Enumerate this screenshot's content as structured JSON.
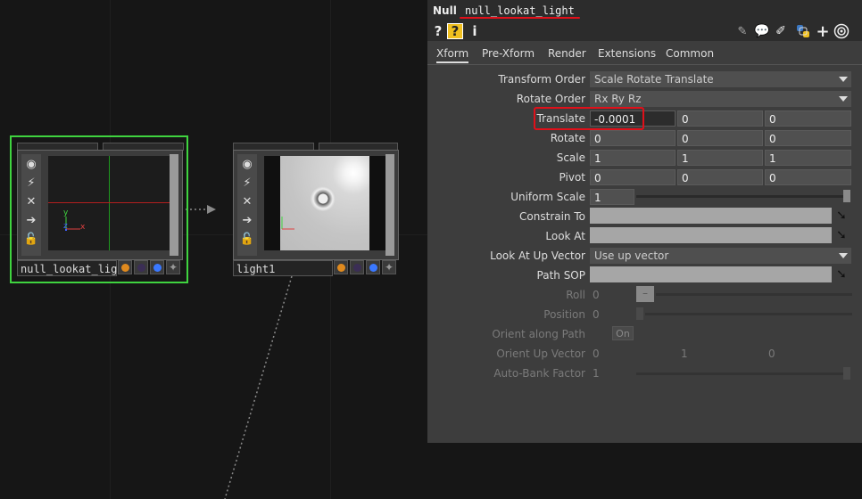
{
  "network": {
    "nodes": [
      {
        "name": "null_lookat_light",
        "selected": true
      },
      {
        "name": "light1",
        "selected": false
      }
    ],
    "side_icons": [
      "viewer-icon",
      "bypass-icon",
      "delete-icon",
      "arrow-right-icon",
      "lock-icon"
    ],
    "flag_colors": [
      "#e08a1e",
      "#3b2e55",
      "#3a78ff",
      "#555555"
    ],
    "axis_labels": {
      "y": "y",
      "z": "z",
      "x": "x"
    }
  },
  "panel": {
    "op_type": "Null",
    "op_name": "null_lookat_light",
    "toolbar": {
      "help": "?",
      "help_python": "?",
      "info": "i"
    },
    "tabs": [
      "Xform",
      "Pre-Xform",
      "Render",
      "Extensions",
      "Common"
    ],
    "active_tab": "Xform",
    "params": {
      "transform_order": {
        "label": "Transform Order",
        "value": "Scale Rotate Translate"
      },
      "rotate_order": {
        "label": "Rotate Order",
        "value": "Rx Ry Rz"
      },
      "translate": {
        "label": "Translate",
        "x": "-0.0001",
        "y": "0",
        "z": "0"
      },
      "rotate": {
        "label": "Rotate",
        "x": "0",
        "y": "0",
        "z": "0"
      },
      "scale": {
        "label": "Scale",
        "x": "1",
        "y": "1",
        "z": "1"
      },
      "pivot": {
        "label": "Pivot",
        "x": "0",
        "y": "0",
        "z": "0"
      },
      "uniform_scale": {
        "label": "Uniform Scale",
        "value": "1"
      },
      "constrain_to": {
        "label": "Constrain To"
      },
      "look_at": {
        "label": "Look At"
      },
      "look_at_up_vector": {
        "label": "Look At Up Vector",
        "value": "Use up vector"
      },
      "path_sop": {
        "label": "Path SOP"
      },
      "roll": {
        "label": "Roll",
        "value": "0"
      },
      "position": {
        "label": "Position",
        "value": "0"
      },
      "orient_along_path": {
        "label": "Orient along Path",
        "value": "On"
      },
      "orient_up_vector": {
        "label": "Orient Up Vector",
        "x": "0",
        "y": "1",
        "z": "0"
      },
      "auto_bank_factor": {
        "label": "Auto-Bank Factor",
        "value": "1"
      }
    }
  },
  "colors": {
    "selected_outline": "#3fd33f",
    "annotation": "#e0101a",
    "background": "#161616"
  }
}
